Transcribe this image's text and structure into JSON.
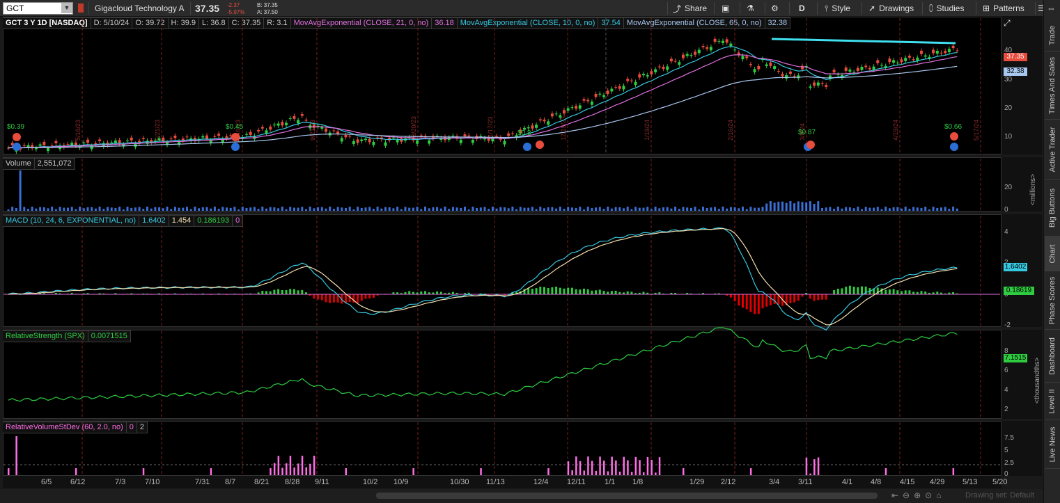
{
  "toolbar": {
    "symbol": "GCT",
    "company": "Gigacloud Technology A",
    "last": "37.35",
    "change": "-2.37",
    "change_pct": "-5.97%",
    "bid": "B: 37.35",
    "ask": "A: 37.50",
    "share": "Share",
    "period": "D",
    "style": "Style",
    "drawings": "Drawings",
    "studies": "Studies",
    "patterns": "Patterns"
  },
  "price": {
    "title": "GCT 3 Y 1D [NASDAQ]",
    "date": "D: 5/10/24",
    "open": "O: 39.72",
    "high": "H: 39.9",
    "low": "L: 36.8",
    "close": "C: 37.35",
    "range": "R: 3.1",
    "ema21_label": "MovAvgExponential (CLOSE, 21, 0, no)",
    "ema21_value": "36.18",
    "ema10_label": "MovAvgExponential (CLOSE, 10, 0, no)",
    "ema10_value": "37.54",
    "ema65_label": "MovAvgExponential (CLOSE, 65, 0, no)",
    "ema65_value": "32.38",
    "ticks": [
      "40",
      "30",
      "20",
      "10"
    ],
    "last_badge": "37.35",
    "ema65_badge": "32.38",
    "event_labels": [
      "$0.39",
      "$0.45",
      "$0.8",
      "$0.87",
      "$0.66"
    ],
    "date_markers": [
      "5/16/23",
      "6/21/23",
      "8/16/23",
      "9/21/23",
      "10/20/23",
      "11/17/23",
      "12/19/23",
      "1/19/24",
      "2/16/24",
      "3/8/24",
      "4/19/24",
      "5/17/24"
    ]
  },
  "volume": {
    "label": "Volume",
    "value": "2,551,072",
    "ticks": [
      "20",
      "0"
    ],
    "unit": "<millions>"
  },
  "macd": {
    "label": "MACD (10, 24, 6, EXPONENTIAL, no)",
    "v1": "1.6402",
    "v2": "1.454",
    "v3": "0.186193",
    "v4": "0",
    "ticks": [
      "4",
      "2",
      "0",
      "-2"
    ],
    "badge_value": "1.6402",
    "badge_diff": "0.18619"
  },
  "rs": {
    "label": "RelativeStrength (SPX)",
    "value": "0.0071515",
    "ticks": [
      "8",
      "6",
      "4",
      "2"
    ],
    "badge": "7.1515",
    "unit": "<thousandths>"
  },
  "rvs": {
    "label": "RelativeVolumeStDev (60, 2.0, no)",
    "v1": "0",
    "v2": "2",
    "ticks": [
      "7.5",
      "5",
      "2.5",
      "0"
    ]
  },
  "xaxis": [
    "6/5",
    "6/12",
    "7/3",
    "7/10",
    "7/31",
    "8/7",
    "8/21",
    "8/28",
    "9/11",
    "10/2",
    "10/9",
    "10/30",
    "11/13",
    "12/4",
    "12/11",
    "1/1",
    "1/8",
    "1/29",
    "2/12",
    "3/4",
    "3/11",
    "4/1",
    "4/8",
    "4/15",
    "4/29",
    "5/13",
    "5/20"
  ],
  "sidebar": [
    "Trade",
    "Times And Sales",
    "Active Trader",
    "Big Buttons",
    "Chart",
    "Phase Scores",
    "Dashboard",
    "Level II",
    "Live News"
  ],
  "footer": {
    "drawing_set": "Drawing set: Default"
  },
  "colors": {
    "bg": "#000000",
    "up": "#2ecc40",
    "down": "#e74c3c",
    "ema10": "#36c8e0",
    "ema21": "#e070e0",
    "ema65": "#a8c8f0",
    "trend": "#40e0f0",
    "rs": "#2ecc40",
    "rvs": "#ff6ee6"
  }
}
